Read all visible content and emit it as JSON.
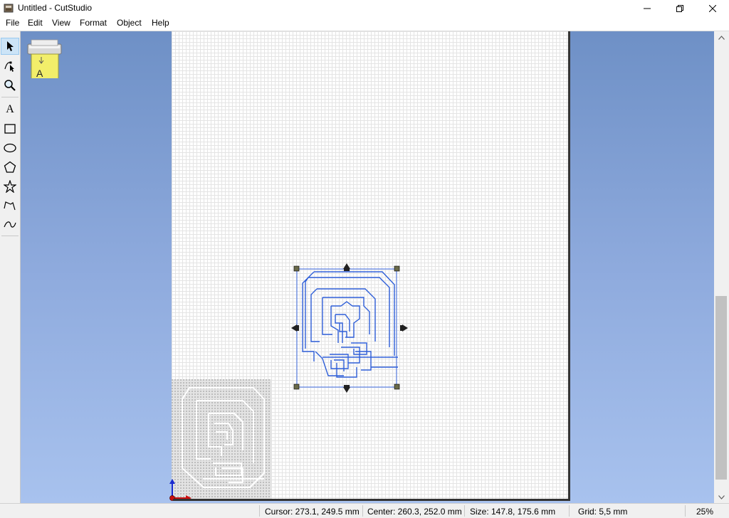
{
  "window": {
    "title": "Untitled - CutStudio",
    "minimize_glyph": "—",
    "restore_glyph": "❐",
    "close_glyph": "✕"
  },
  "menu": {
    "items": [
      "File",
      "Edit",
      "View",
      "Format",
      "Object",
      "Help"
    ]
  },
  "toolbar": {
    "tools": [
      {
        "name": "select-tool",
        "icon": "arrow-pointer-icon",
        "active": true
      },
      {
        "name": "node-edit-tool",
        "icon": "node-edit-icon"
      },
      {
        "name": "zoom-tool",
        "icon": "magnifier-icon"
      },
      {
        "name": "text-tool",
        "icon": "text-A-icon"
      },
      {
        "name": "rectangle-tool",
        "icon": "rectangle-icon"
      },
      {
        "name": "ellipse-tool",
        "icon": "ellipse-icon"
      },
      {
        "name": "polygon-tool",
        "icon": "pentagon-icon"
      },
      {
        "name": "star-tool",
        "icon": "star-icon"
      },
      {
        "name": "polyline-tool",
        "icon": "polyline-icon"
      },
      {
        "name": "curve-tool",
        "icon": "curve-icon"
      }
    ],
    "text_glyph": "A"
  },
  "canvas": {
    "cutter_icon": "cutter-machine-icon",
    "cutter_icon_letter": "A",
    "workspace_color": "#7b9bd2",
    "selection_color": "#2f5fd8",
    "origin_axis_colors": {
      "y": "#1a2ad0",
      "x": "#cc1010"
    }
  },
  "status": {
    "cursor": "Cursor: 273.1, 249.5 mm",
    "center": "Center: 260.3, 252.0 mm",
    "size": "Size: 147.8, 175.6 mm",
    "grid": "Grid: 5,5 mm",
    "zoom": "25%"
  }
}
